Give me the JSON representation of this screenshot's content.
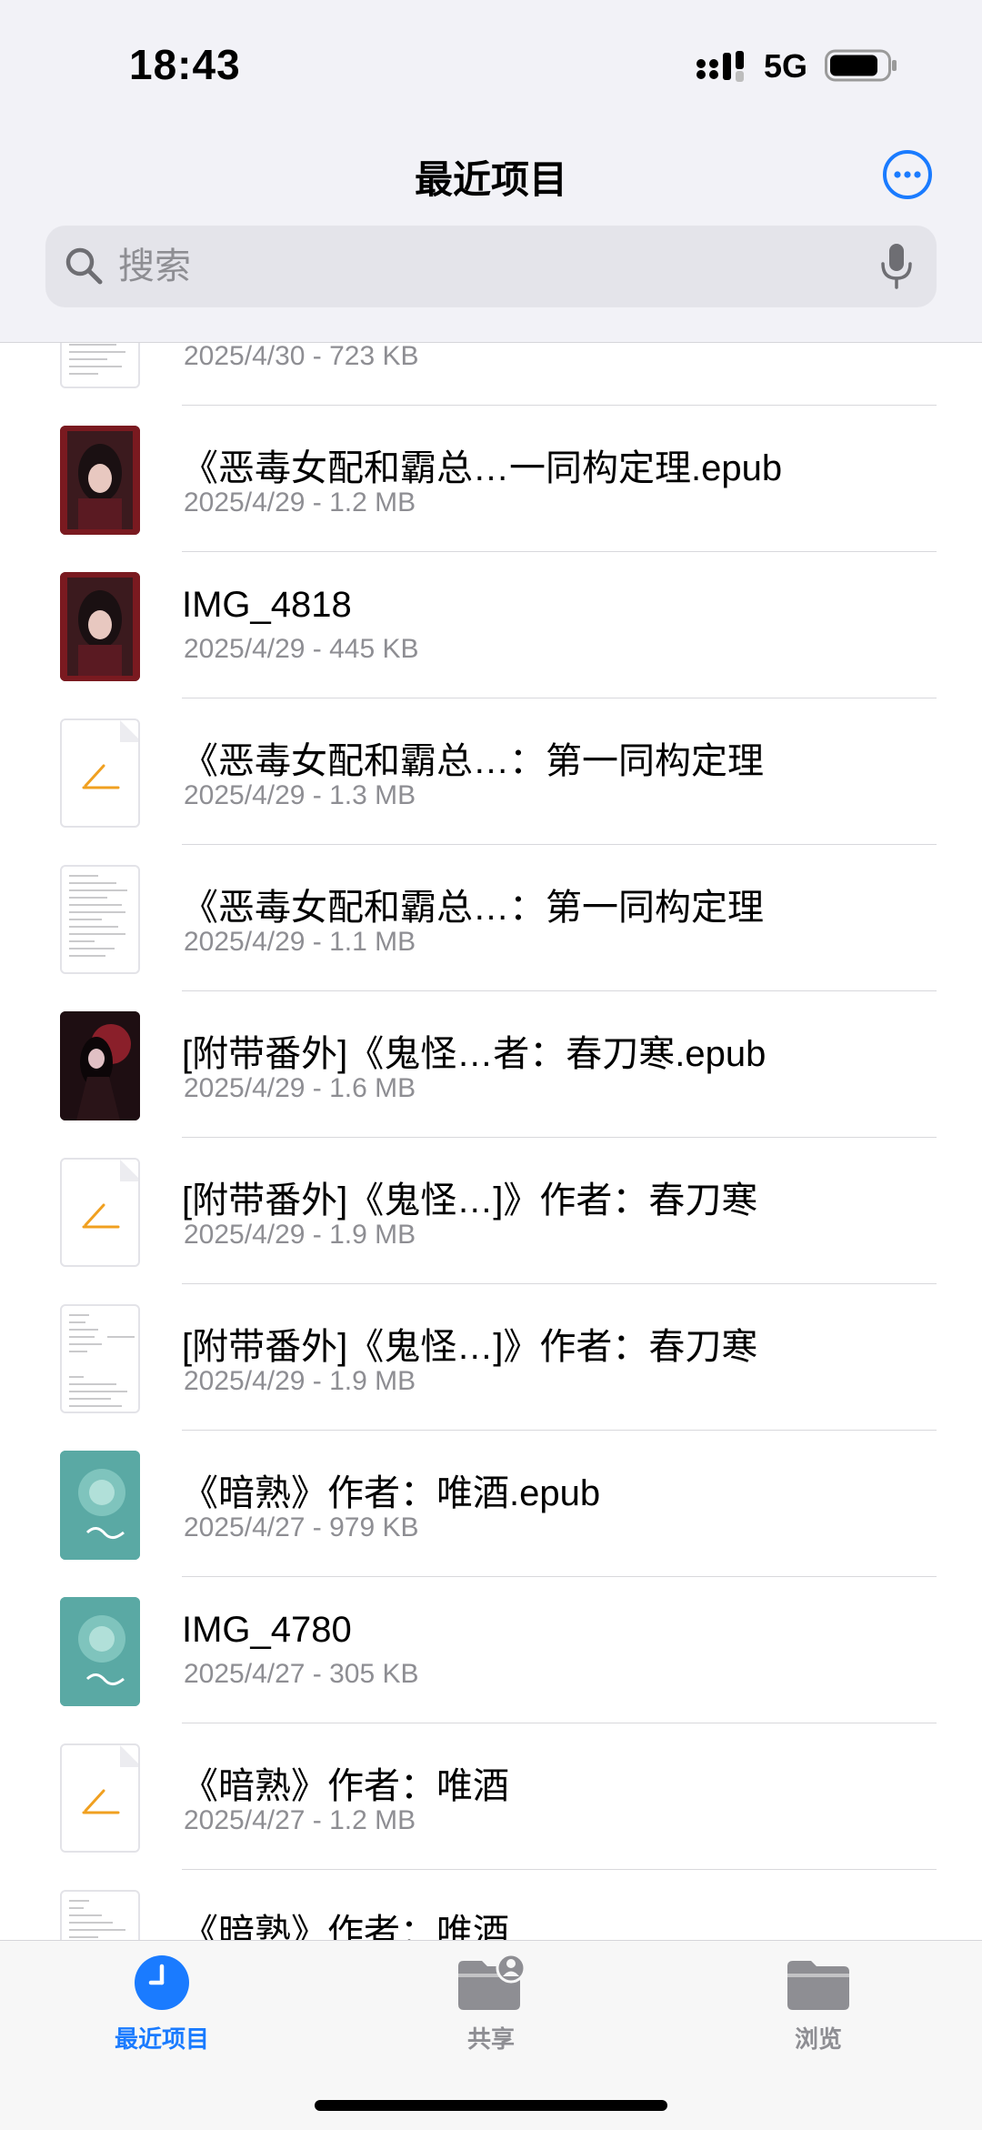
{
  "status_bar": {
    "time": "18:43",
    "network": "5G"
  },
  "nav": {
    "title": "最近项目"
  },
  "search": {
    "placeholder": "搜索",
    "value": ""
  },
  "files": [
    {
      "name": "",
      "meta": "2025/4/30 - 723 KB",
      "thumb": "text-doc"
    },
    {
      "name": "《恶毒女配和霸总…一同构定理.epub",
      "meta": "2025/4/29 - 1.2 MB",
      "thumb": "book-cover-red"
    },
    {
      "name": "IMG_4818",
      "meta": "2025/4/29 - 445 KB",
      "thumb": "book-cover-red"
    },
    {
      "name": "《恶毒女配和霸总…：第一同构定理",
      "meta": "2025/4/29 - 1.3 MB",
      "thumb": "pages-doc"
    },
    {
      "name": "《恶毒女配和霸总…：第一同构定理",
      "meta": "2025/4/29 - 1.1 MB",
      "thumb": "text-doc"
    },
    {
      "name": "[附带番外]《鬼怪…者：春刀寒.epub",
      "meta": "2025/4/29 - 1.6 MB",
      "thumb": "book-cover-dark"
    },
    {
      "name": "[附带番外]《鬼怪…]》作者：春刀寒",
      "meta": "2025/4/29 - 1.9 MB",
      "thumb": "pages-doc"
    },
    {
      "name": "[附带番外]《鬼怪…]》作者：春刀寒",
      "meta": "2025/4/29 - 1.9 MB",
      "thumb": "text-doc"
    },
    {
      "name": "《暗熟》作者：唯酒.epub",
      "meta": "2025/4/27 - 979 KB",
      "thumb": "book-cover-teal"
    },
    {
      "name": "IMG_4780",
      "meta": "2025/4/27 - 305 KB",
      "thumb": "book-cover-teal"
    },
    {
      "name": "《暗熟》作者：唯酒",
      "meta": "2025/4/27 - 1.2 MB",
      "thumb": "pages-doc"
    },
    {
      "name": "《暗熟》作者：唯酒",
      "meta": "",
      "thumb": "text-doc"
    }
  ],
  "tabs": [
    {
      "label": "最近项目",
      "icon": "clock-icon",
      "active": true
    },
    {
      "label": "共享",
      "icon": "shared-folder-icon",
      "active": false
    },
    {
      "label": "浏览",
      "icon": "folder-icon",
      "active": false
    }
  ],
  "colors": {
    "accent": "#1a7bff",
    "secondary_text": "#8e8e93",
    "background": "#f2f2f7"
  }
}
